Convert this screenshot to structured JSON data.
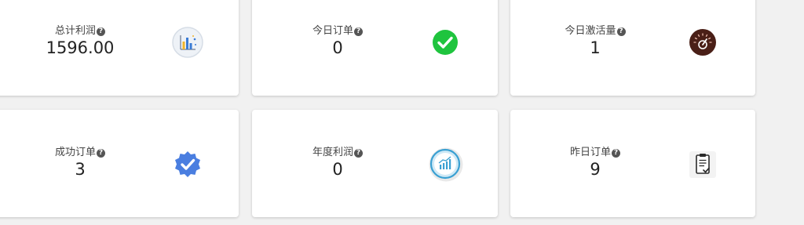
{
  "stats": [
    {
      "label": "总计利润",
      "value": "1596.00",
      "icon": "bar-chart-icon"
    },
    {
      "label": "今日订单",
      "value": "0",
      "icon": "check-circle-icon"
    },
    {
      "label": "今日激活量",
      "value": "1",
      "icon": "speedometer-icon"
    },
    {
      "label": "成功订单",
      "value": "3",
      "icon": "verified-badge-icon"
    },
    {
      "label": "年度利润",
      "value": "0",
      "icon": "trend-chart-icon"
    },
    {
      "label": "昨日订单",
      "value": "9",
      "icon": "clipboard-check-icon"
    }
  ],
  "help_symbol": "?",
  "colors": {
    "background": "#f1f1f1",
    "card": "#ffffff",
    "check_green": "#1fc43e",
    "gauge_brown": "#4a1f17",
    "badge_blue": "#4a7ee0"
  }
}
